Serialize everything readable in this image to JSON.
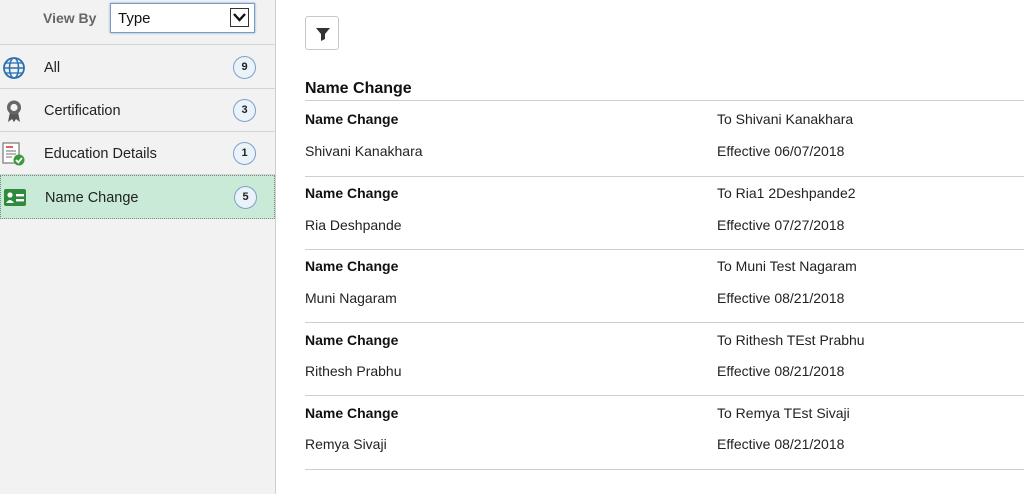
{
  "sidebar": {
    "viewby_label": "View By",
    "viewby_value": "Type",
    "items": [
      {
        "label": "All",
        "count": "9",
        "icon": "globe-icon"
      },
      {
        "label": "Certification",
        "count": "3",
        "icon": "ribbon-icon"
      },
      {
        "label": "Education Details",
        "count": "1",
        "icon": "document-check-icon"
      },
      {
        "label": "Name Change",
        "count": "5",
        "icon": "id-card-icon"
      }
    ]
  },
  "main": {
    "section_title": "Name Change",
    "rows": [
      {
        "title": "Name Change",
        "name": "Shivani Kanakhara",
        "to": "To Shivani Kanakhara",
        "effective": "Effective 06/07/2018"
      },
      {
        "title": "Name Change",
        "name": "Ria Deshpande",
        "to": "To Ria1 2Deshpande2",
        "effective": "Effective 07/27/2018"
      },
      {
        "title": "Name Change",
        "name": "Muni Nagaram",
        "to": "To Muni Test Nagaram",
        "effective": "Effective 08/21/2018"
      },
      {
        "title": "Name Change",
        "name": "Rithesh Prabhu",
        "to": "To Rithesh TEst Prabhu",
        "effective": "Effective 08/21/2018"
      },
      {
        "title": "Name Change",
        "name": "Remya Sivaji",
        "to": "To Remya TEst Sivaji",
        "effective": "Effective 08/21/2018"
      }
    ]
  }
}
